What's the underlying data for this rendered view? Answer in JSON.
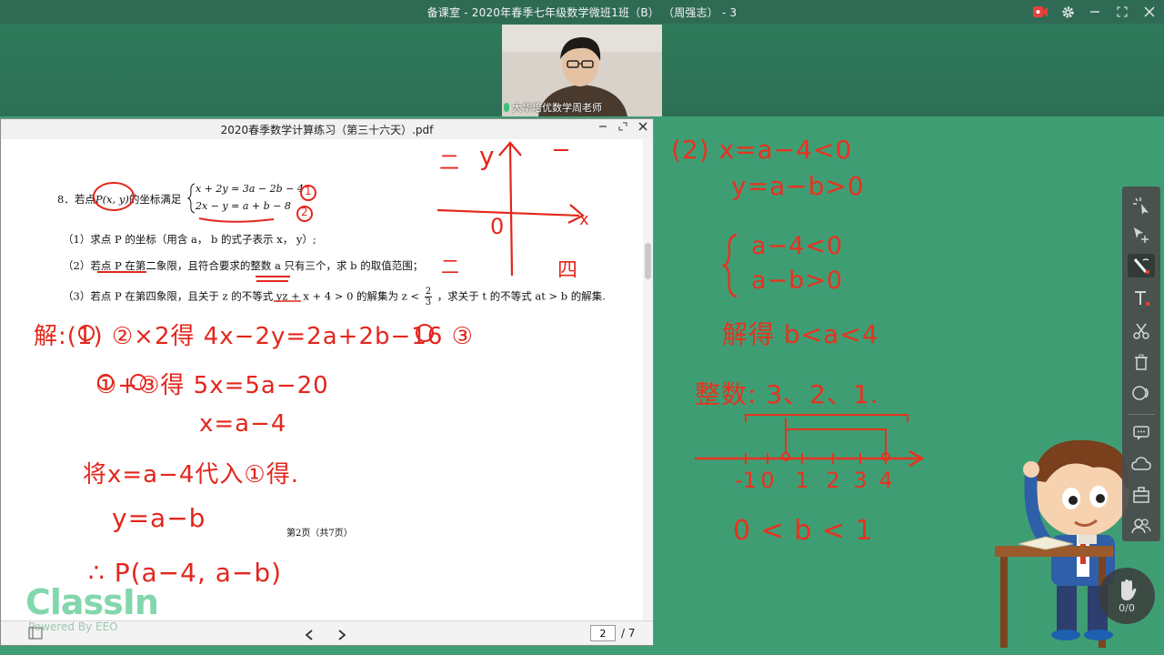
{
  "window": {
    "title": "备课室 - 2020年春季七年级数学微班1班（B） （周强志） - 3"
  },
  "video": {
    "name_label": "大华培优数学周老师"
  },
  "pdf": {
    "filename": "2020春季数学计算练习（第三十六天）.pdf",
    "current_page": "2",
    "total_pages": "/ 7",
    "page_footer": "第2页（共7页）",
    "problem": {
      "stem_prefix": "8．若点",
      "stem_point": "P(x, y)",
      "stem_suffix": "的坐标满足",
      "eq1": "x + 2y = 3a − 2b − 4",
      "eq2": "2x − y = a + b − 8",
      "part1": "（1）求点 P 的坐标（用含 a， b 的式子表示 x， y）;",
      "part2": "（2）若点 P 在第二象限，且符合要求的整数 a 只有三个，求 b 的取值范围；",
      "part3_a": "（3）若点 P 在第四象限，且关于 z 的不等式 yz + x + 4 > 0 的解集为 z <",
      "part3_frac_num": "2",
      "part3_frac_den": "3",
      "part3_b": "，求关于 t 的不等式 at > b 的解集."
    }
  },
  "handwriting": {
    "page_eq": "二",
    "axis_y": "y",
    "axis_x": "x",
    "origin": "0",
    "quad": "四",
    "step1": "解:(1) ②×2得 4x−2y=2a+2b−16 ③",
    "step2": "①+③得 5x=5a−20",
    "step3": "x=a−4",
    "step4": "将x=a−4代入①得.",
    "step5": "y=a−b",
    "step6": "∴ P(a−4, a−b)",
    "c1": "1",
    "c2": "2"
  },
  "board": {
    "l1": "(2)  x=a−4<0",
    "l2": "y=a−b>0",
    "l3": "a−4<0",
    "l4": "a−b>0",
    "l5": "解得 b<a<4",
    "l6": "整数: 3、2、1.",
    "numline": [
      "-1",
      "0",
      "1",
      "2",
      "3",
      "4"
    ],
    "l7": "0 < b < 1"
  },
  "brand": {
    "logo": "ClassIn",
    "powered": "Powered By EEO"
  },
  "hand_raise": {
    "count": "0/0"
  },
  "colors": {
    "ink": "#e3261c",
    "board": "#3f9d74",
    "top": "#2e7a5b"
  }
}
